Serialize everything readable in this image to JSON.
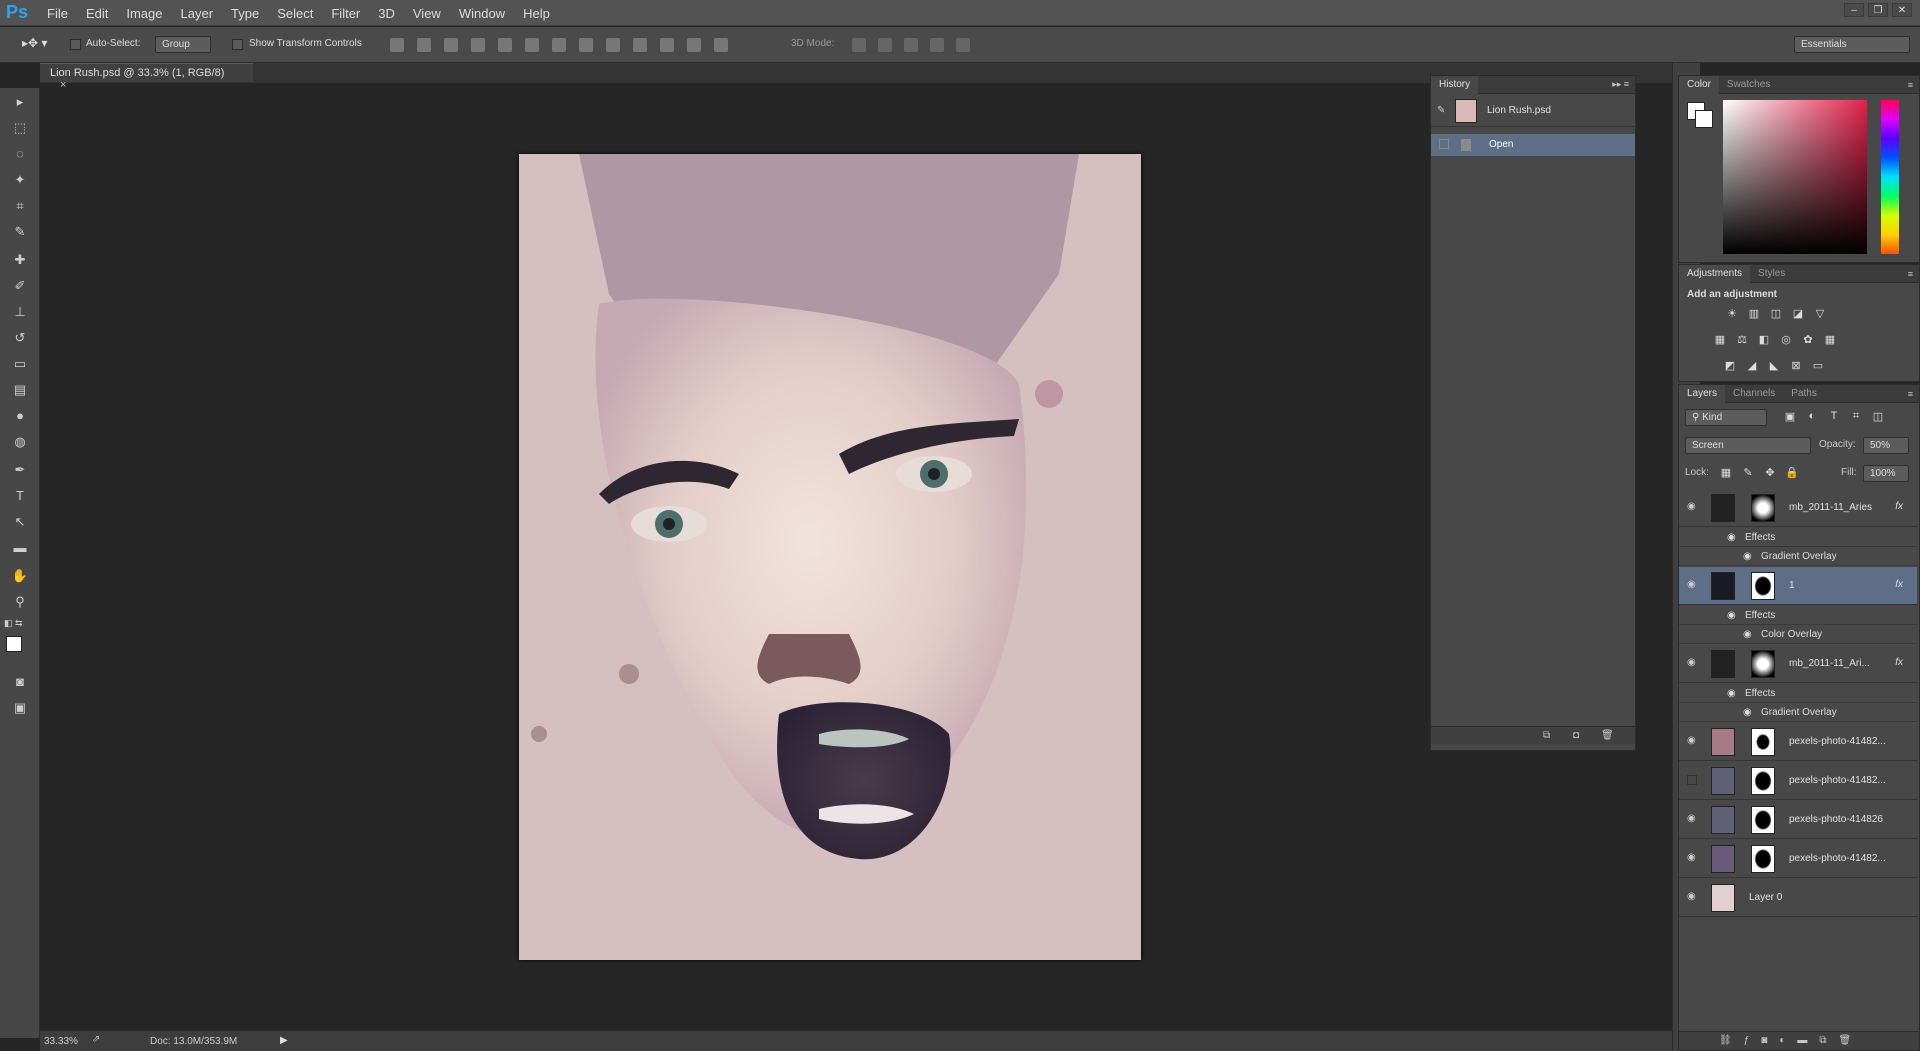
{
  "app": {
    "logo": "Ps"
  },
  "menu": [
    "File",
    "Edit",
    "Image",
    "Layer",
    "Type",
    "Select",
    "Filter",
    "3D",
    "View",
    "Window",
    "Help"
  ],
  "window_buttons": [
    "–",
    "❐",
    "✕"
  ],
  "options": {
    "auto_select_label": "Auto-Select:",
    "auto_select_value": "Group",
    "transform_label": "Show Transform Controls",
    "mode_3d_label": "3D Mode:",
    "workspace": "Essentials"
  },
  "document": {
    "tab_title": "Lion Rush.psd @ 33.3% (1, RGB/8)",
    "close": "×"
  },
  "status": {
    "zoom": "33.33%",
    "doc": "Doc: 13.0M/353.9M"
  },
  "history": {
    "tab": "History",
    "snapshot": "Lion Rush.psd",
    "steps": [
      "Open"
    ]
  },
  "color_panel": {
    "tabs": [
      "Color",
      "Swatches"
    ]
  },
  "adjustments": {
    "tabs": [
      "Adjustments",
      "Styles"
    ],
    "heading": "Add an adjustment"
  },
  "layers_panel": {
    "tabs": [
      "Layers",
      "Channels",
      "Paths"
    ],
    "filter": "Kind",
    "blend_mode": "Screen",
    "opacity_label": "Opacity:",
    "opacity": "50%",
    "lock_label": "Lock:",
    "fill_label": "Fill:",
    "fill": "100%",
    "layers": [
      {
        "name": "mb_2011-11_Aries",
        "fx": "fx",
        "effects_label": "Effects",
        "effect": "Gradient Overlay"
      },
      {
        "name": "1",
        "fx": "fx",
        "effects_label": "Effects",
        "effect": "Color Overlay"
      },
      {
        "name": "mb_2011-11_Ari...",
        "fx": "fx",
        "effects_label": "Effects",
        "effect": "Gradient Overlay"
      },
      {
        "name": "pexels-photo-41482..."
      },
      {
        "name": "pexels-photo-41482..."
      },
      {
        "name": "pexels-photo-414826"
      },
      {
        "name": "pexels-photo-41482..."
      },
      {
        "name": "Layer 0"
      }
    ]
  },
  "colors": {
    "accent": "#2fa3e6",
    "selected_layer": "#5d6e86",
    "history_selected": "#5d6e86"
  }
}
